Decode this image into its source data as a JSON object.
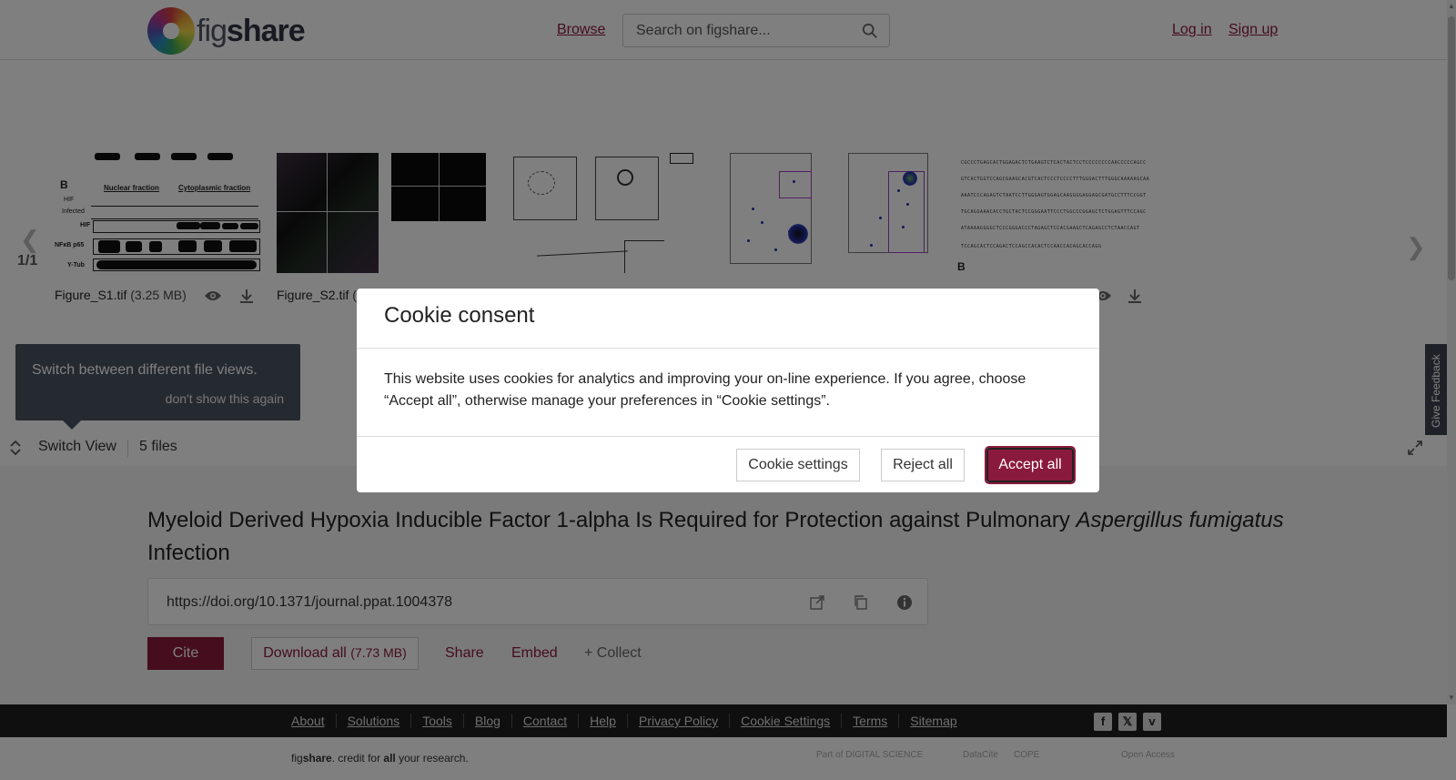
{
  "header": {
    "logo_text_light": "fig",
    "logo_text_bold": "share",
    "browse": "Browse",
    "search_placeholder": "Search on figshare...",
    "login": "Log in",
    "signup": "Sign up"
  },
  "carousel": {
    "page_count": "1/1",
    "thumb_labels": {
      "fig_b": "B",
      "nuclear_fraction": "Nuclear fraction",
      "cytoplasmic_fraction": "Cytoplasmic fraction",
      "hif": "HIF",
      "nfkb": "NFκB p65",
      "ytub": "Y-Tub",
      "hifc": "HIF",
      "infected": "Infected",
      "seq_label_b": "B"
    },
    "files": [
      {
        "name": "Figure_S1.tif",
        "size": "(3.25 MB)"
      },
      {
        "name": "Figure_S2.tif",
        "size": "("
      }
    ]
  },
  "tooltip": {
    "text": "Switch between different file views.",
    "dismiss": "don't show this again"
  },
  "switchbar": {
    "label": "Switch View",
    "files_count": "5 files"
  },
  "article": {
    "title_part1": "Myeloid Derived Hypoxia Inducible Factor 1-alpha Is Required for Protection against Pulmonary ",
    "title_italic": "Aspergillus fumigatus",
    "title_part2": " Infection",
    "doi": "https://doi.org/10.1371/journal.ppat.1004378",
    "cite": "Cite",
    "download_all": "Download all",
    "download_size": "(7.73 MB)",
    "share": "Share",
    "embed": "Embed",
    "collect": "+ Collect"
  },
  "footer": {
    "links": [
      "About",
      "Solutions",
      "Tools",
      "Blog",
      "Contact",
      "Help",
      "Privacy Policy",
      "Cookie Settings",
      "Terms",
      "Sitemap"
    ],
    "credit_fig": "fig",
    "credit_share": "share",
    "credit_mid": ". credit for ",
    "credit_all": "all",
    "credit_end": " your research.",
    "partners": [
      "Part of DIGITAL SCIENCE",
      "DataCite",
      "COPE",
      "Open Access"
    ]
  },
  "feedback": "Give Feedback",
  "cookie": {
    "title": "Cookie consent",
    "text": "This website uses cookies for analytics and improving your on-line experience. If you agree, choose “Accept all”, otherwise manage your preferences in “Cookie settings”.",
    "settings": "Cookie settings",
    "reject": "Reject all",
    "accept": "Accept all"
  },
  "colors": {
    "brand": "#8a1a3d",
    "footer_bg": "#1f1f1f",
    "tooltip_bg": "#4a5360"
  }
}
